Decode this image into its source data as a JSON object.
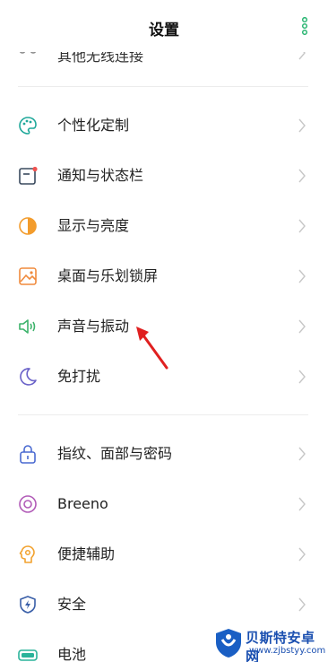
{
  "header": {
    "title": "设置",
    "menu_icon": "more-vertical-icon",
    "accent": "#2bb673"
  },
  "cut_row": {
    "label": "其他无线连接",
    "icon": "wireless-icon"
  },
  "group1": [
    {
      "label": "个性化定制",
      "icon": "palette-icon"
    },
    {
      "label": "通知与状态栏",
      "icon": "notification-icon"
    },
    {
      "label": "显示与亮度",
      "icon": "brightness-icon"
    },
    {
      "label": "桌面与乐划锁屏",
      "icon": "wallpaper-icon"
    },
    {
      "label": "声音与振动",
      "icon": "speaker-icon"
    },
    {
      "label": "免打扰",
      "icon": "moon-icon"
    }
  ],
  "group2": [
    {
      "label": "指纹、面部与密码",
      "icon": "lock-icon"
    },
    {
      "label": "Breeno",
      "icon": "breeno-icon"
    },
    {
      "label": "便捷辅助",
      "icon": "assist-icon"
    },
    {
      "label": "安全",
      "icon": "shield-icon"
    },
    {
      "label": "电池",
      "icon": "battery-icon"
    }
  ],
  "watermark": {
    "name": "贝斯特安卓网",
    "url": "www.zjbstyy.com"
  }
}
